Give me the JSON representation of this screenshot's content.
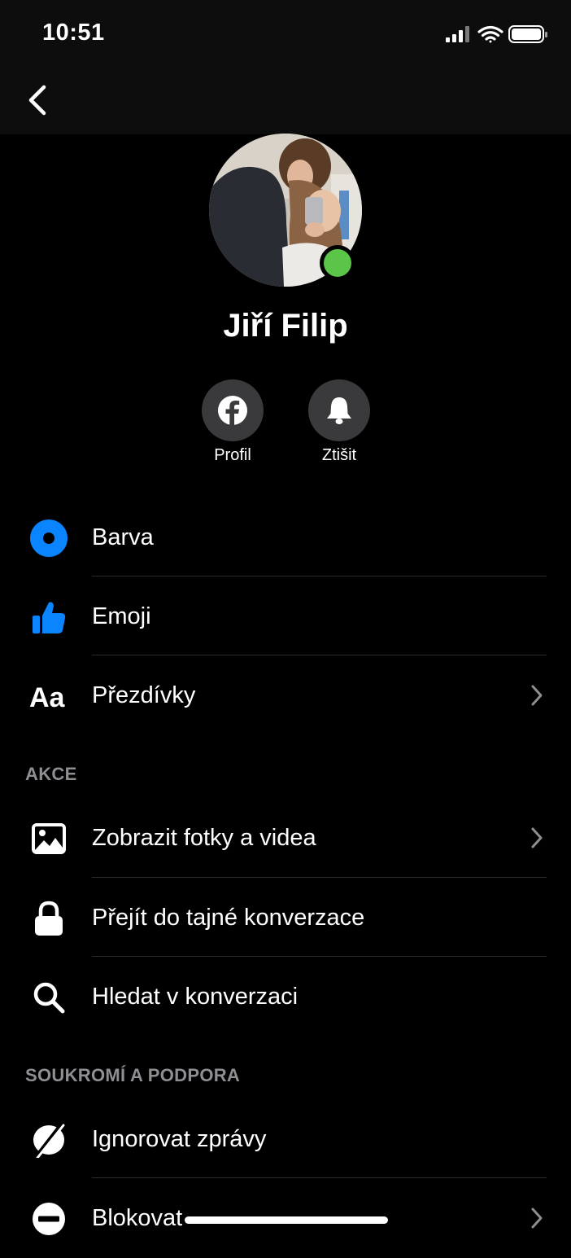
{
  "status_bar": {
    "time": "10:51"
  },
  "profile": {
    "name": "Jiří Filip",
    "online": true
  },
  "quick_actions": [
    {
      "label": "Profil",
      "icon": "facebook-icon"
    },
    {
      "label": "Ztišit",
      "icon": "bell-icon"
    }
  ],
  "settings": [
    {
      "label": "Barva",
      "icon": "color-dot-icon",
      "chevron": false
    },
    {
      "label": "Emoji",
      "icon": "thumbs-up-icon",
      "chevron": false
    },
    {
      "label": "Přezdívky",
      "icon": "text-aa-icon",
      "chevron": true
    }
  ],
  "actions_header": "AKCE",
  "actions": [
    {
      "label": "Zobrazit fotky a videa",
      "icon": "photo-icon",
      "chevron": true
    },
    {
      "label": "Přejít do tajné konverzace",
      "icon": "lock-icon",
      "chevron": false
    },
    {
      "label": "Hledat v konverzaci",
      "icon": "search-icon",
      "chevron": false
    }
  ],
  "privacy_header": "SOUKROMÍ A PODPORA",
  "privacy": [
    {
      "label": "Ignorovat zprávy",
      "icon": "ignore-icon",
      "chevron": false
    },
    {
      "label": "Blokovat",
      "icon": "block-icon",
      "chevron": true
    }
  ],
  "colors": {
    "accent": "#0a84ff",
    "online": "#5ac548",
    "separator": "#2c2c2e",
    "section": "#8e8e93"
  }
}
